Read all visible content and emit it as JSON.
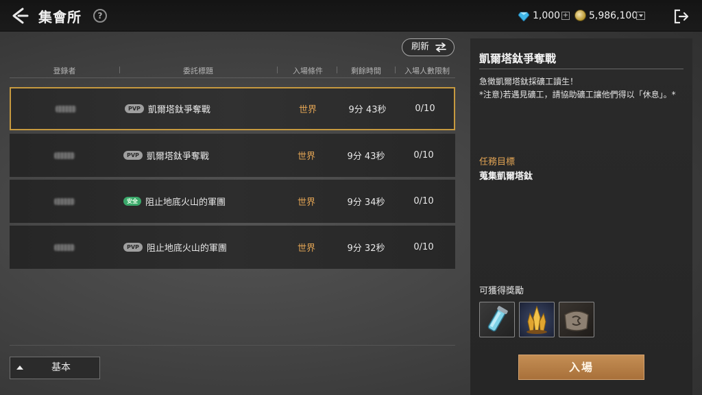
{
  "header": {
    "title": "集會所",
    "help_glyph": "?",
    "gems": "1,000",
    "coins": "5,986,100",
    "plus_glyph": "+"
  },
  "toolbar": {
    "refresh_label": "刷新"
  },
  "table": {
    "columns": [
      "登錄者",
      "委託標題",
      "入場條件",
      "剩餘時間",
      "入場人數限制"
    ],
    "rows": [
      {
        "badge": "PVP",
        "badge_type": "pvp",
        "title": "凱爾塔鈦爭奪戰",
        "condition": "世界",
        "time": "9分 43秒",
        "capacity": "0/10",
        "selected": true
      },
      {
        "badge": "PVP",
        "badge_type": "pvp",
        "title": "凱爾塔鈦爭奪戰",
        "condition": "世界",
        "time": "9分 43秒",
        "capacity": "0/10",
        "selected": false
      },
      {
        "badge": "安全",
        "badge_type": "safe",
        "title": "阻止地底火山的軍團",
        "condition": "世界",
        "time": "9分 34秒",
        "capacity": "0/10",
        "selected": false
      },
      {
        "badge": "PVP",
        "badge_type": "pvp",
        "title": "阻止地底火山的軍團",
        "condition": "世界",
        "time": "9分 32秒",
        "capacity": "0/10",
        "selected": false
      }
    ]
  },
  "footer": {
    "basic_label": "基本"
  },
  "detail": {
    "title": "凱爾塔鈦爭奪戰",
    "desc_line1": "急徵凱爾塔鈦採礦工讀生！",
    "desc_line2": "*注意)若遇見礦工，請協助礦工讓他們得以「休息」。*",
    "goal_label": "任務目標",
    "goal_value": "蒐集凱爾塔鈦",
    "reward_label": "可獲得獎勵",
    "rewards": [
      "crystal-vial-icon",
      "gold-crystal-icon",
      "scroll-pouch-icon"
    ],
    "enter_label": "入場"
  },
  "colors": {
    "accent": "#e2a454",
    "selected_border": "#c79a3f",
    "enter_button": "#b57d46",
    "safe_badge": "#3aa86a"
  }
}
